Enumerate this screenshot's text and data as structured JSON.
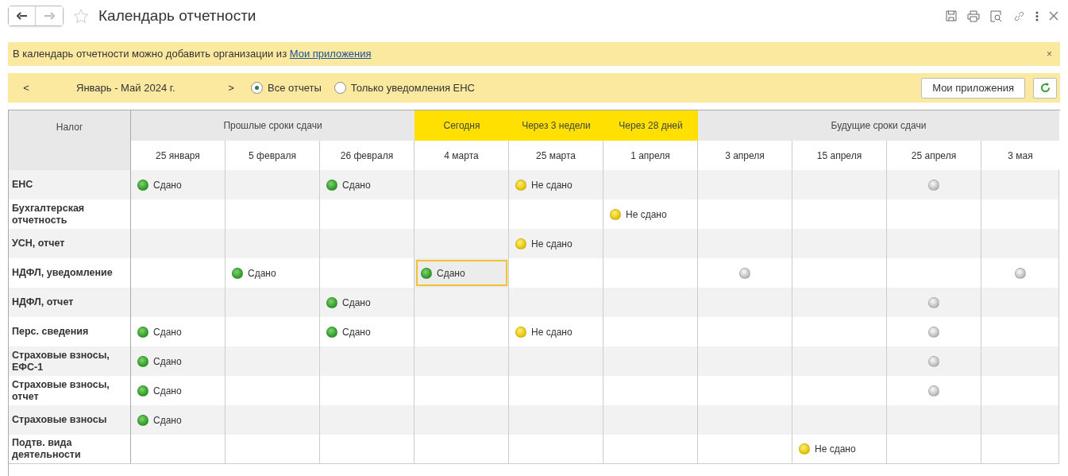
{
  "window": {
    "title": "Календарь отчетности",
    "favorite": false
  },
  "info_bar": {
    "text": "В календарь отчетности можно добавить организации из",
    "link": "Мои приложения",
    "close": "×"
  },
  "filter_bar": {
    "prev": "<",
    "period": "Январь - Май 2024 г.",
    "next": ">",
    "options": [
      {
        "label": "Все отчеты",
        "selected": true
      },
      {
        "label": "Только уведомления ЕНС",
        "selected": false
      }
    ],
    "button": "Мои приложения"
  },
  "table": {
    "first_column": "Налог",
    "groups": [
      {
        "label": "Прошлые сроки сдачи",
        "highlighted": false,
        "dates": [
          "25 января",
          "5 февраля",
          "26 февраля"
        ]
      },
      {
        "label": "Сегодня",
        "highlighted": true,
        "dates": [
          "4 марта"
        ]
      },
      {
        "label": "Через 3 недели",
        "highlighted": true,
        "dates": [
          "25 марта"
        ]
      },
      {
        "label": "Через 28 дней",
        "highlighted": true,
        "dates": [
          "1 апреля"
        ]
      },
      {
        "label": "Будущие сроки сдачи",
        "highlighted": false,
        "dates": [
          "3 апреля",
          "15 апреля",
          "25 апреля",
          "3 мая"
        ]
      }
    ],
    "rows": [
      {
        "name": "ЕНС",
        "cells": [
          {
            "kind": "done",
            "text": "Сдано",
            "selected": false
          },
          {
            "kind": "empty",
            "selected": false
          },
          {
            "kind": "done",
            "text": "Сдано",
            "selected": false
          },
          {
            "kind": "empty",
            "selected": false
          },
          {
            "kind": "pending",
            "text": "Не сдано",
            "selected": false
          },
          {
            "kind": "empty",
            "selected": false
          },
          {
            "kind": "empty",
            "selected": false
          },
          {
            "kind": "empty",
            "selected": false
          },
          {
            "kind": "planned",
            "selected": false
          },
          {
            "kind": "empty",
            "selected": false
          }
        ]
      },
      {
        "name": "Бухгалтерская отчетность",
        "cells": [
          {
            "kind": "empty",
            "selected": false
          },
          {
            "kind": "empty",
            "selected": false
          },
          {
            "kind": "empty",
            "selected": false
          },
          {
            "kind": "empty",
            "selected": false
          },
          {
            "kind": "empty",
            "selected": false
          },
          {
            "kind": "pending",
            "text": "Не сдано",
            "selected": false
          },
          {
            "kind": "empty",
            "selected": false
          },
          {
            "kind": "empty",
            "selected": false
          },
          {
            "kind": "empty",
            "selected": false
          },
          {
            "kind": "empty",
            "selected": false
          }
        ]
      },
      {
        "name": "УСН, отчет",
        "cells": [
          {
            "kind": "empty",
            "selected": false
          },
          {
            "kind": "empty",
            "selected": false
          },
          {
            "kind": "empty",
            "selected": false
          },
          {
            "kind": "empty",
            "selected": false
          },
          {
            "kind": "pending",
            "text": "Не сдано",
            "selected": false
          },
          {
            "kind": "empty",
            "selected": false
          },
          {
            "kind": "empty",
            "selected": false
          },
          {
            "kind": "empty",
            "selected": false
          },
          {
            "kind": "empty",
            "selected": false
          },
          {
            "kind": "empty",
            "selected": false
          }
        ]
      },
      {
        "name": "НДФЛ, уведомление",
        "cells": [
          {
            "kind": "empty",
            "selected": false
          },
          {
            "kind": "done",
            "text": "Сдано",
            "selected": false
          },
          {
            "kind": "empty",
            "selected": false
          },
          {
            "kind": "done",
            "text": "Сдано",
            "selected": true
          },
          {
            "kind": "empty",
            "selected": false
          },
          {
            "kind": "empty",
            "selected": false
          },
          {
            "kind": "planned",
            "selected": false
          },
          {
            "kind": "empty",
            "selected": false
          },
          {
            "kind": "empty",
            "selected": false
          },
          {
            "kind": "planned",
            "selected": false
          }
        ]
      },
      {
        "name": "НДФЛ, отчет",
        "cells": [
          {
            "kind": "empty",
            "selected": false
          },
          {
            "kind": "empty",
            "selected": false
          },
          {
            "kind": "done",
            "text": "Сдано",
            "selected": false
          },
          {
            "kind": "empty",
            "selected": false
          },
          {
            "kind": "empty",
            "selected": false
          },
          {
            "kind": "empty",
            "selected": false
          },
          {
            "kind": "empty",
            "selected": false
          },
          {
            "kind": "empty",
            "selected": false
          },
          {
            "kind": "planned",
            "selected": false
          },
          {
            "kind": "empty",
            "selected": false
          }
        ]
      },
      {
        "name": "Перс. сведения",
        "cells": [
          {
            "kind": "done",
            "text": "Сдано",
            "selected": false
          },
          {
            "kind": "empty",
            "selected": false
          },
          {
            "kind": "done",
            "text": "Сдано",
            "selected": false
          },
          {
            "kind": "empty",
            "selected": false
          },
          {
            "kind": "pending",
            "text": "Не сдано",
            "selected": false
          },
          {
            "kind": "empty",
            "selected": false
          },
          {
            "kind": "empty",
            "selected": false
          },
          {
            "kind": "empty",
            "selected": false
          },
          {
            "kind": "planned",
            "selected": false
          },
          {
            "kind": "empty",
            "selected": false
          }
        ]
      },
      {
        "name": "Страховые взносы, ЕФС-1",
        "cells": [
          {
            "kind": "done",
            "text": "Сдано",
            "selected": false
          },
          {
            "kind": "empty",
            "selected": false
          },
          {
            "kind": "empty",
            "selected": false
          },
          {
            "kind": "empty",
            "selected": false
          },
          {
            "kind": "empty",
            "selected": false
          },
          {
            "kind": "empty",
            "selected": false
          },
          {
            "kind": "empty",
            "selected": false
          },
          {
            "kind": "empty",
            "selected": false
          },
          {
            "kind": "planned",
            "selected": false
          },
          {
            "kind": "empty",
            "selected": false
          }
        ]
      },
      {
        "name": "Страховые взносы, отчет",
        "cells": [
          {
            "kind": "done",
            "text": "Сдано",
            "selected": false
          },
          {
            "kind": "empty",
            "selected": false
          },
          {
            "kind": "empty",
            "selected": false
          },
          {
            "kind": "empty",
            "selected": false
          },
          {
            "kind": "empty",
            "selected": false
          },
          {
            "kind": "empty",
            "selected": false
          },
          {
            "kind": "empty",
            "selected": false
          },
          {
            "kind": "empty",
            "selected": false
          },
          {
            "kind": "planned",
            "selected": false
          },
          {
            "kind": "empty",
            "selected": false
          }
        ]
      },
      {
        "name": "Страховые взносы",
        "cells": [
          {
            "kind": "done",
            "text": "Сдано",
            "selected": false
          },
          {
            "kind": "empty",
            "selected": false
          },
          {
            "kind": "empty",
            "selected": false
          },
          {
            "kind": "empty",
            "selected": false
          },
          {
            "kind": "empty",
            "selected": false
          },
          {
            "kind": "empty",
            "selected": false
          },
          {
            "kind": "empty",
            "selected": false
          },
          {
            "kind": "empty",
            "selected": false
          },
          {
            "kind": "empty",
            "selected": false
          },
          {
            "kind": "empty",
            "selected": false
          }
        ]
      },
      {
        "name": "Подтв. вида деятельности",
        "cells": [
          {
            "kind": "empty",
            "selected": false
          },
          {
            "kind": "empty",
            "selected": false
          },
          {
            "kind": "empty",
            "selected": false
          },
          {
            "kind": "empty",
            "selected": false
          },
          {
            "kind": "empty",
            "selected": false
          },
          {
            "kind": "empty",
            "selected": false
          },
          {
            "kind": "empty",
            "selected": false
          },
          {
            "kind": "pending",
            "text": "Не сдано",
            "selected": false
          },
          {
            "kind": "empty",
            "selected": false
          },
          {
            "kind": "empty",
            "selected": false
          }
        ]
      }
    ]
  }
}
